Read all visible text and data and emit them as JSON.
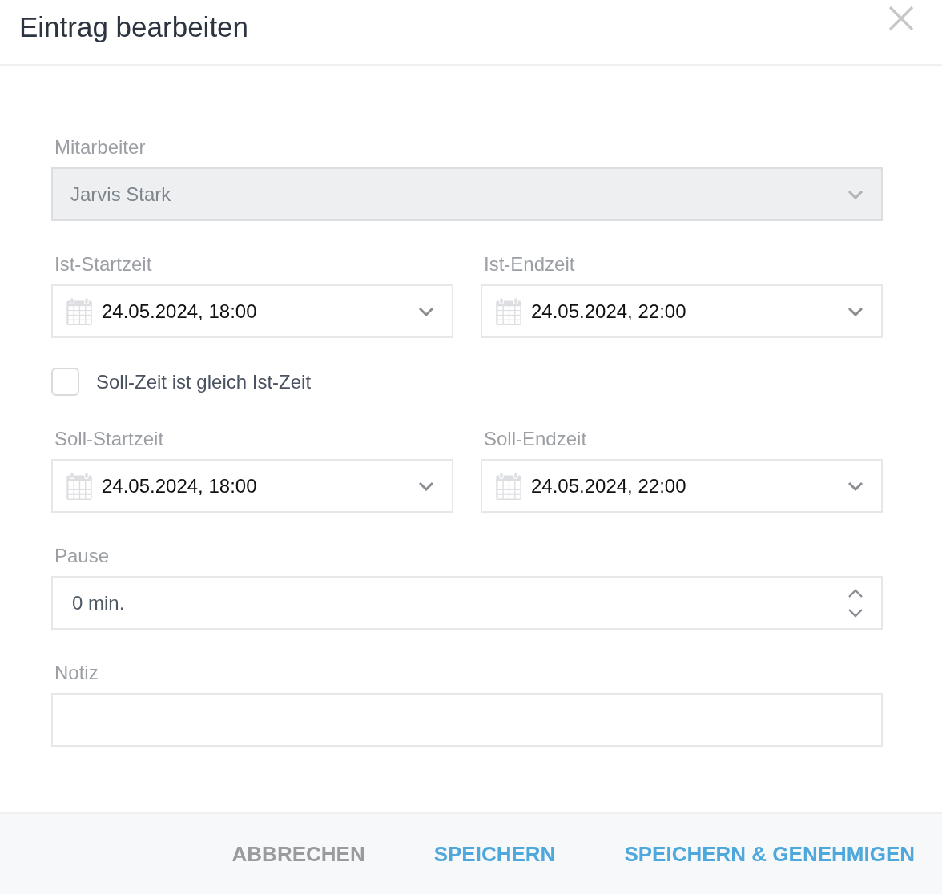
{
  "dialog": {
    "title": "Eintrag bearbeiten"
  },
  "employee": {
    "label": "Mitarbeiter",
    "value": "Jarvis Stark",
    "disabled": true
  },
  "actual_time": [
    {
      "label": "Ist-Startzeit",
      "value": "24.05.2024, 18:00"
    },
    {
      "label": "Ist-Endzeit",
      "value": "24.05.2024, 22:00"
    }
  ],
  "same_time_checkbox": {
    "label": "Soll-Zeit ist gleich Ist-Zeit",
    "checked": false
  },
  "planned_time": [
    {
      "label": "Soll-Startzeit",
      "value": "24.05.2024, 18:00"
    },
    {
      "label": "Soll-Endzeit",
      "value": "24.05.2024, 22:00"
    }
  ],
  "break": {
    "label": "Pause",
    "value": "0 min."
  },
  "note": {
    "label": "Notiz"
  },
  "buttons": [
    {
      "label": "ABBRECHEN",
      "kind": "cancel"
    },
    {
      "label": "SPEICHERN",
      "kind": "primary"
    },
    {
      "label": "SPEICHERN & GENEHMIGEN",
      "kind": "primary"
    }
  ]
}
